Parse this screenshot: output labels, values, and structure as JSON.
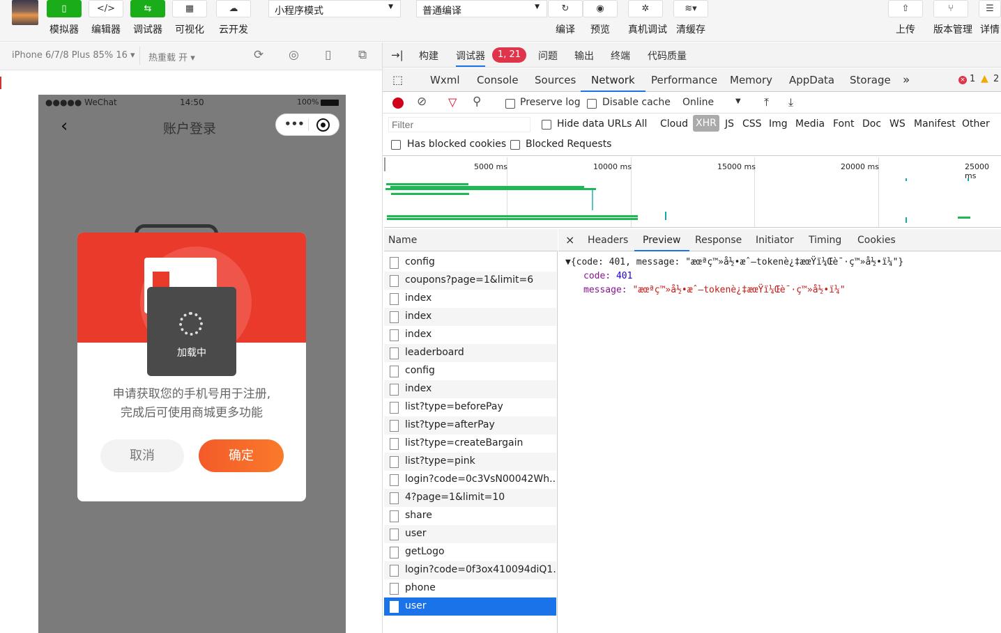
{
  "toolbar": {
    "simulator": "模拟器",
    "editor": "编辑器",
    "debugger": "调试器",
    "visual": "可视化",
    "cloud": "云开发",
    "mode_select": "小程序模式",
    "compile_select": "普通编译",
    "compile": "编译",
    "preview": "预览",
    "remote_debug": "真机调试",
    "clear_cache": "清缓存",
    "upload": "上传",
    "version": "版本管理",
    "details": "详情"
  },
  "simbar": {
    "device": "iPhone 6/7/8 Plus 85% 16 ▾",
    "hot_reload": "热重载 开 ▾"
  },
  "phone": {
    "carrier": "●●●●● WeChat",
    "time": "14:50",
    "battery": "100%",
    "nav_title": "账户登录",
    "modal_text_1": "申请获取您的手机号用于注册,",
    "modal_text_2": "完成后可使用商城更多功能",
    "cancel": "取消",
    "confirm": "确定",
    "loading": "加载中"
  },
  "devtools": {
    "top_tabs": [
      "构建",
      "调试器",
      "问题",
      "输出",
      "终端",
      "代码质量"
    ],
    "badge": "1, 21",
    "panels": [
      "Wxml",
      "Console",
      "Sources",
      "Network",
      "Performance",
      "Memory",
      "AppData",
      "Storage"
    ],
    "active_panel": "Network",
    "more": "»",
    "errors": "1",
    "warnings": "2",
    "preserve_log": "Preserve log",
    "disable_cache": "Disable cache",
    "throttle": "Online",
    "filter_placeholder": "Filter",
    "hide_data_urls": "Hide data URLs",
    "types": [
      "All",
      "Cloud",
      "XHR",
      "JS",
      "CSS",
      "Img",
      "Media",
      "Font",
      "Doc",
      "WS",
      "Manifest",
      "Other"
    ],
    "active_type": "XHR",
    "has_blocked": "Has blocked cookies",
    "blocked_requests": "Blocked Requests",
    "timeline_ticks": [
      "5000 ms",
      "10000 ms",
      "15000 ms",
      "20000 ms",
      "25000 ms"
    ],
    "name_header": "Name",
    "requests": [
      "config",
      "coupons?page=1&limit=6",
      "index",
      "index",
      "index",
      "leaderboard",
      "config",
      "index",
      "list?type=beforePay",
      "list?type=afterPay",
      "list?type=createBargain",
      "list?type=pink",
      "login?code=0c3VsN00042Wh...",
      "4?page=1&limit=10",
      "share",
      "user",
      "getLogo",
      "login?code=0f3ox410094diQ1...",
      "phone",
      "user"
    ],
    "selected_request": 19,
    "close": "×",
    "detail_tabs": [
      "Headers",
      "Preview",
      "Response",
      "Initiator",
      "Timing",
      "Cookies"
    ],
    "active_detail": "Preview",
    "preview_line": "{code: 401, message: \"æœªç™»å½•æˆ–tokenè¿‡æœŸï¼Œè¯·ç™»å½•ï¼\"}",
    "code_key": "code:",
    "code_val": "401",
    "msg_key": "message:",
    "msg_val": "\"æœªç™»å½•æˆ–tokenè¿‡æœŸï¼Œè¯·ç™»å½•ï¼\""
  }
}
